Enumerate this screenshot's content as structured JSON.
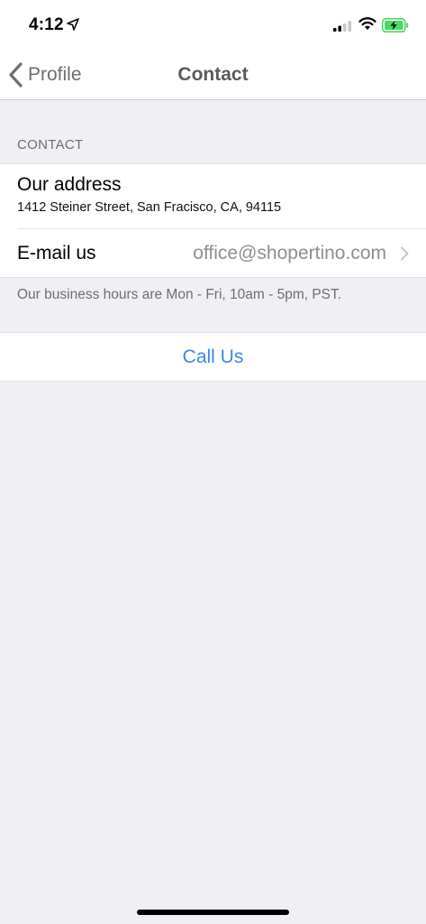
{
  "status_bar": {
    "time": "4:12",
    "icons": [
      "location-arrow-icon",
      "signal-icon",
      "wifi-icon",
      "battery-charging-icon"
    ],
    "battery_color": "#4cd964"
  },
  "nav": {
    "back_label": "Profile",
    "title": "Contact"
  },
  "section": {
    "header": "CONTACT"
  },
  "address": {
    "title": "Our address",
    "value": "1412 Steiner Street, San Fracisco, CA, 94115"
  },
  "email": {
    "label": "E-mail us",
    "value": "office@shopertino.com"
  },
  "footer_note": "Our business hours are Mon - Fri, 10am - 5pm, PST.",
  "call": {
    "label": "Call Us",
    "color": "#3a86f0"
  }
}
